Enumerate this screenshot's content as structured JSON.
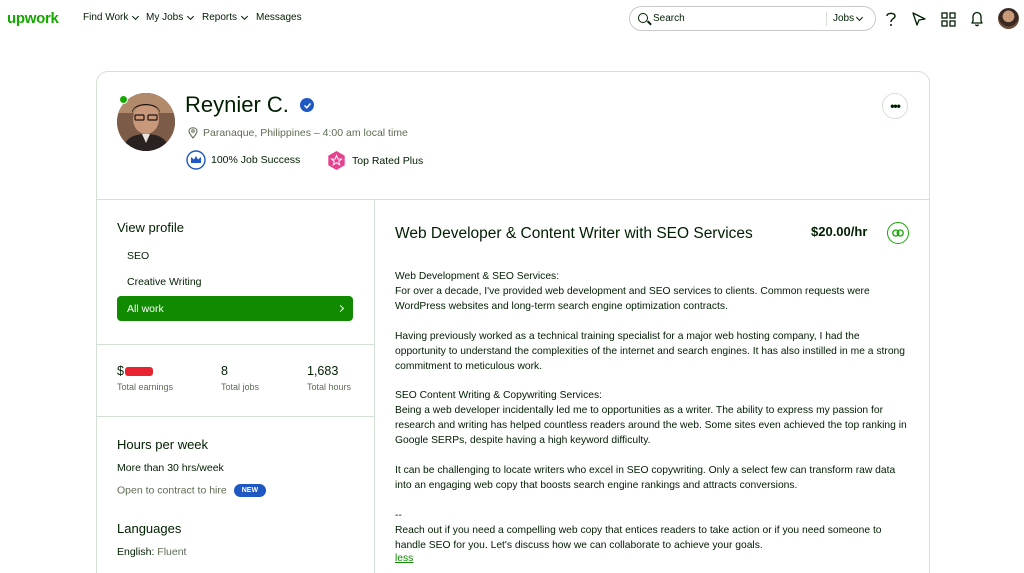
{
  "nav": {
    "logo": "upwork",
    "links": [
      "Find Work",
      "My Jobs",
      "Reports",
      "Messages"
    ],
    "search_placeholder": "Search",
    "search_scope": "Jobs"
  },
  "profile": {
    "name": "Reynier C.",
    "location": "Paranaque, Philippines – 4:00 am local time",
    "job_success": "100% Job Success",
    "top_rated": "Top Rated Plus",
    "more_label": "•••"
  },
  "sidebar": {
    "view_profile": "View profile",
    "items": [
      "SEO",
      "Creative Writing"
    ],
    "all_work": "All work",
    "stats": {
      "earnings_prefix": "$",
      "earnings_label": "Total earnings",
      "jobs_value": "8",
      "jobs_label": "Total jobs",
      "hours_value": "1,683",
      "hours_label": "Total hours"
    },
    "hours_title": "Hours per week",
    "hours_value": "More than 30 hrs/week",
    "contract_to_hire": "Open to contract to hire",
    "new_badge": "NEW",
    "languages_title": "Languages",
    "language_name": "English:",
    "language_level": "Fluent"
  },
  "main": {
    "title": "Web Developer & Content Writer with SEO Services",
    "rate": "$20.00/hr",
    "paragraphs": [
      [
        "Web Development & SEO Services:",
        "For over a decade, I've provided web development and SEO services to clients. Common requests were",
        "WordPress websites and long-term search engine optimization contracts."
      ],
      [
        "Having previously worked as a technical training specialist for a major web hosting company, I had the",
        "opportunity to understand the complexities of the internet and search engines. It has also instilled in me a strong",
        "commitment to meticulous work."
      ],
      [
        "SEO Content Writing & Copywriting Services:",
        "Being a web developer incidentally led me to opportunities as a writer. The ability to express my passion for",
        "research and writing has helped countless readers around the web. Some sites even achieved the top ranking in",
        "Google SERPs, despite having a high keyword difficulty."
      ],
      [
        "It can be challenging to locate writers who excel in SEO copywriting. Only a select few can transform raw data",
        "into an engaging web copy that boosts search engine rankings and attracts conversions."
      ],
      [
        "--",
        "Reach out if you need a compelling web copy that entices readers to take action or if you need someone to",
        "handle SEO for you. Let's discuss how we can collaborate to achieve your goals."
      ]
    ],
    "less_link": "less"
  },
  "colors": {
    "brand": "#14a800",
    "button": "#108a00",
    "verified": "#1f57c3",
    "top_rated": "#e5418e"
  }
}
